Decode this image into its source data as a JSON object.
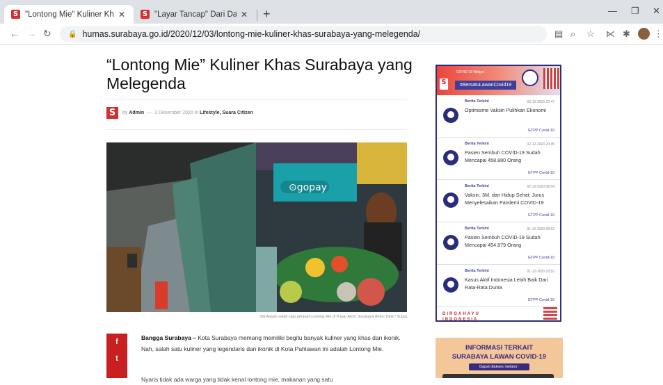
{
  "browser": {
    "tabs": [
      {
        "title": "\"Lontong Mie\" Kuliner Khas Surab",
        "close": "✕"
      },
      {
        "title": "\"Layar Tancap\" Dari Dalam Mobil",
        "close": "✕"
      }
    ],
    "new_tab": "+",
    "url": "humas.surabaya.go.id/2020/12/03/lontong-mie-kuliner-khas-surabaya-yang-melegenda/",
    "window_controls": [
      "—",
      "❐",
      "✕"
    ]
  },
  "article": {
    "title": "“Lontong Mie” Kuliner Khas Surabaya yang Melegenda",
    "author_prefix": "by",
    "author": "Admin",
    "date": "3 Desember 2020",
    "category_prefix": "in",
    "categories": "Lifestyle, Suara Citizen",
    "photo_caption": "Sili Aisyah salah satu penjual Lontong Mie di Pasar Atom Surabaya (Foto: Dink / Sugg)",
    "lead_bold": "Bangga Surabaya –",
    "lead_text": "Kota Surabaya memang memiliki begitu banyak kuliner yang khas dan ikonik. Nah, salah satu kuliner yang legendaris dan ikonik di Kota Pahlawan ini adalah Lontong Mie.",
    "second_para": "Nyaris tidak ada warga yang tidak kenal lontong mie, makanan yang satu"
  },
  "share": {
    "facebook": "f",
    "twitter": "t"
  },
  "widget": {
    "top_label": "COVID-19 Widget",
    "hashtag": "#BersatuLawanCovid19",
    "items": [
      {
        "category": "Berita Terkini",
        "date": "03-12-2020 10:47",
        "text": "Optimisme Vaksin Pulihkan Ekonomi",
        "source": "GTPP Covid-19"
      },
      {
        "category": "Berita Terkini",
        "date": "02-12-2020 20:45",
        "text": "Pasien Sembuh COVID-19 Sudah Mencapai 458.880 Orang",
        "source": "GTPP Covid-19"
      },
      {
        "category": "Berita Terkini",
        "date": "02-12-2020 08:54",
        "text": "Vaksin, 3M, dan Hidup Sehat: Jurus Menyelesaikan Pandemi COVID-19",
        "source": "GTPP Covid-19"
      },
      {
        "category": "Berita Terkini",
        "date": "01-12-2020 08:52",
        "text": "Pasien Sembuh COVID-19 Sudah Mencapai 454.879 Orang",
        "source": "GTPP Covid-19"
      },
      {
        "category": "Berita Terkini",
        "date": "01-12-2020 16:50",
        "text": "Kasus Aktif Indonesia Lebih Baik Dari Rata-Rata Dunia",
        "source": "GTPP Covid-19"
      }
    ],
    "footer_line1": "DIRGAHAYU",
    "footer_line2": "INDONESIA"
  },
  "banner": {
    "line1": "INFORMASI TERKAIT",
    "line2": "SURABAYA LAWAN COVID-19",
    "pill": "Dapat diakses melalui :"
  },
  "colors": {
    "accent": "#c91f20",
    "widget_navy": "#2b2d7a",
    "banner_bg": "#f4c79b"
  }
}
